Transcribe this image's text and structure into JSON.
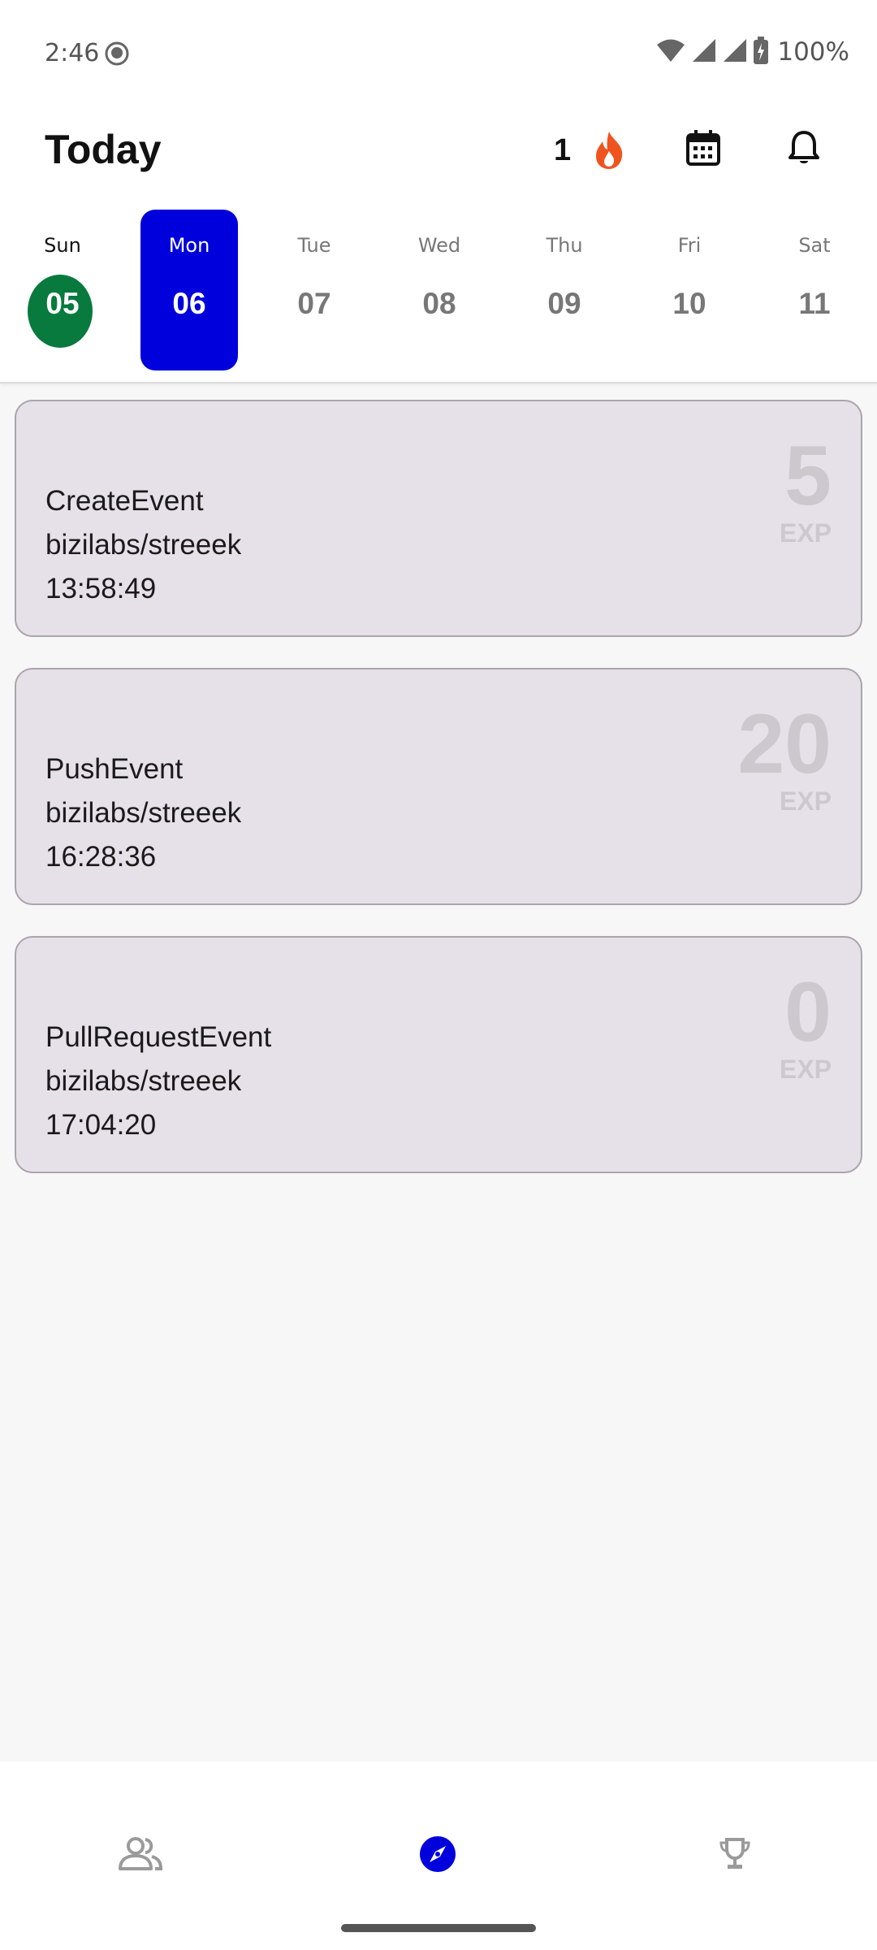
{
  "status_bar": {
    "time": "2:46",
    "battery": "100%"
  },
  "header": {
    "title": "Today",
    "streak_count": "1"
  },
  "week": {
    "days": [
      {
        "name": "Sun",
        "num": "05",
        "state": "today"
      },
      {
        "name": "Mon",
        "num": "06",
        "state": "selected"
      },
      {
        "name": "Tue",
        "num": "07",
        "state": "normal"
      },
      {
        "name": "Wed",
        "num": "08",
        "state": "normal"
      },
      {
        "name": "Thu",
        "num": "09",
        "state": "normal"
      },
      {
        "name": "Fri",
        "num": "10",
        "state": "normal"
      },
      {
        "name": "Sat",
        "num": "11",
        "state": "normal"
      }
    ]
  },
  "events": [
    {
      "type": "CreateEvent",
      "repo": "bizilabs/streeek",
      "time": "13:58:49",
      "exp": "5",
      "exp_label": "EXP"
    },
    {
      "type": "PushEvent",
      "repo": "bizilabs/streeek",
      "time": "16:28:36",
      "exp": "20",
      "exp_label": "EXP"
    },
    {
      "type": "PullRequestEvent",
      "repo": "bizilabs/streeek",
      "time": "17:04:20",
      "exp": "0",
      "exp_label": "EXP"
    }
  ],
  "colors": {
    "selected_day": "#0000dd",
    "today_circle": "#087a3e",
    "streak_flame": "#f0541e",
    "card_background": "#e6e0e8",
    "nav_active": "#0000dd"
  },
  "icons": {
    "streak": "flame-icon",
    "calendar": "calendar-icon",
    "notifications": "bell-icon",
    "nav_friends": "people-icon",
    "nav_explore": "compass-icon",
    "nav_leaderboard": "trophy-icon"
  }
}
